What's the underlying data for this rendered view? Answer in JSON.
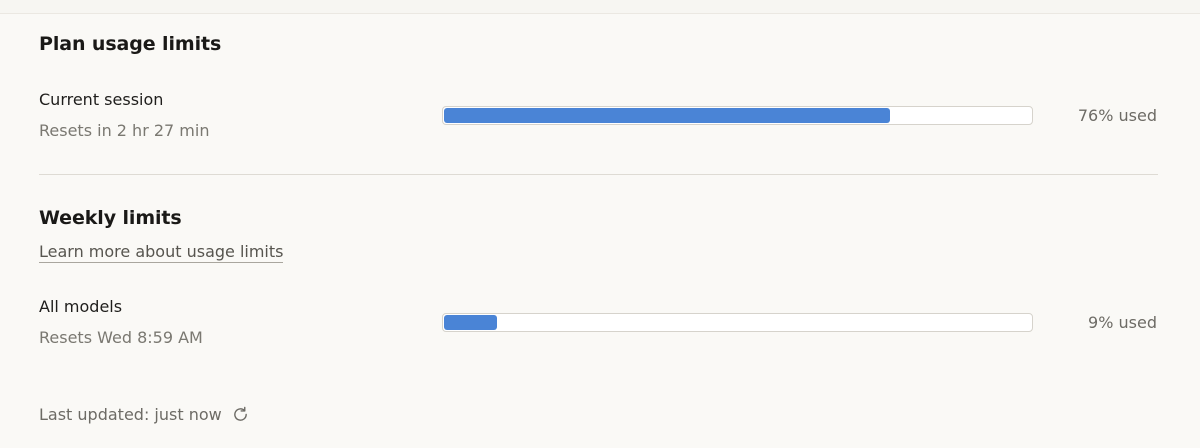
{
  "plan": {
    "title": "Plan usage limits",
    "session": {
      "label": "Current session",
      "reset": "Resets in 2 hr 27 min",
      "used_percent": 76,
      "used_label": "76% used"
    }
  },
  "weekly": {
    "title": "Weekly limits",
    "learn_more": "Learn more about usage limits",
    "all_models": {
      "label": "All models",
      "reset": "Resets Wed 8:59 AM",
      "used_percent": 9,
      "used_label": "9% used"
    }
  },
  "footer": {
    "last_updated": "Last updated: just now",
    "refresh_icon": "refresh-icon"
  },
  "colors": {
    "background": "#faf9f6",
    "bar_fill": "#4a84d6",
    "bar_track": "#ffffff"
  }
}
